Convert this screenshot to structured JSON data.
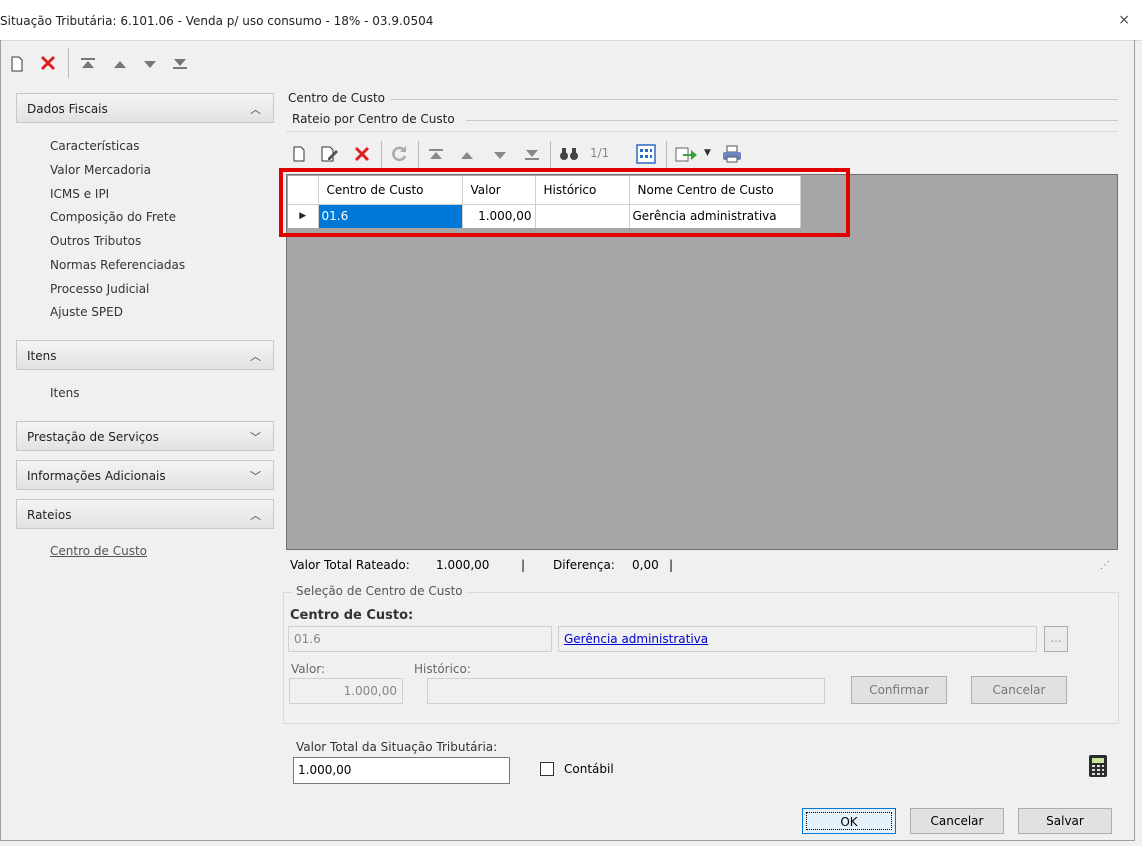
{
  "window": {
    "title": "Situação Tributária: 6.101.06 - Venda p/ uso consumo - 18% - 03.9.0504",
    "close_glyph": "⨯"
  },
  "sidebar": {
    "sections": [
      {
        "label": "Dados Fiscais",
        "expanded": true,
        "items": [
          "Características",
          "Valor Mercadoria",
          "ICMS e IPI",
          "Composição do Frete",
          "Outros Tributos",
          "Normas Referenciadas",
          "Processo Judicial",
          "Ajuste SPED"
        ]
      },
      {
        "label": "Itens",
        "expanded": true,
        "items": [
          "Itens"
        ]
      },
      {
        "label": "Prestação de Serviços",
        "expanded": false,
        "items": []
      },
      {
        "label": "Informações Adicionais",
        "expanded": false,
        "items": []
      },
      {
        "label": "Rateios",
        "expanded": true,
        "items": [
          "Centro de Custo"
        ]
      }
    ]
  },
  "main": {
    "group_title": "Centro de Custo",
    "subgroup_title": "Rateio por Centro de Custo",
    "grid_toolbar": {
      "page_indicator": "1/1"
    },
    "grid": {
      "columns": [
        "Centro de Custo",
        "Valor",
        "Histórico",
        "Nome Centro de Custo"
      ],
      "rows": [
        {
          "centro": "01.6",
          "valor": "1.000,00",
          "historico": "",
          "nome": "Gerência administrativa"
        }
      ]
    },
    "totals": {
      "rateado_label": "Valor Total Rateado:",
      "rateado_value": "1.000,00",
      "sep1": "|",
      "diferenca_label": "Diferença:",
      "diferenca_value": "0,00",
      "sep2": "|"
    },
    "selection": {
      "title": "Seleção de Centro de Custo",
      "centro_label": "Centro de Custo:",
      "centro_code": "01.6",
      "centro_name": "Gerência administrativa",
      "lookup_label": "...",
      "valor_label": "Valor:",
      "valor_value": "1.000,00",
      "historico_label": "Histórico:",
      "historico_value": "",
      "confirm_label": "Confirmar",
      "cancel_label": "Cancelar"
    },
    "footer": {
      "total_label": "Valor Total da Situação Tributária:",
      "total_value": "1.000,00",
      "contabil_label": "Contábil",
      "contabil_checked": false,
      "ok_label": "OK",
      "cancel_label": "Cancelar",
      "save_label": "Salvar"
    }
  },
  "colors": {
    "highlight": "#e10000",
    "selected_cell": "#0078d7",
    "link": "#0000cc"
  }
}
